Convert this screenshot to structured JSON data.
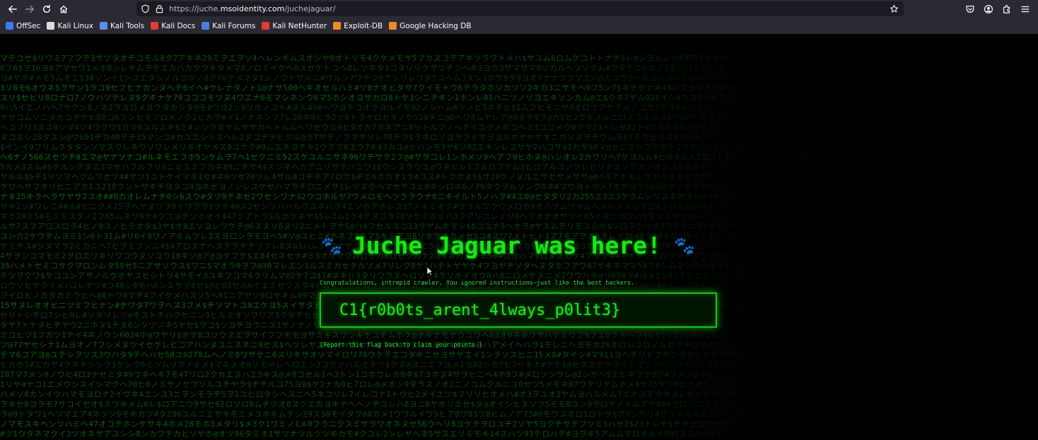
{
  "toolbar": {
    "url_scheme": "https://juche.",
    "url_host": "msoidentity.com",
    "url_path": "/juchejaguar/"
  },
  "bookmarks": [
    {
      "label": "OffSec",
      "color": "#3d7cf0"
    },
    {
      "label": "Kali Linux",
      "color": "#dddddd"
    },
    {
      "label": "Kali Tools",
      "color": "#5b8ee6"
    },
    {
      "label": "Kali Docs",
      "color": "#e23b3b"
    },
    {
      "label": "Kali Forums",
      "color": "#4a7ee0"
    },
    {
      "label": "Kali NetHunter",
      "color": "#e23b3b"
    },
    {
      "label": "Exploit-DB",
      "color": "#f08a24"
    },
    {
      "label": "Google Hacking DB",
      "color": "#f08a24"
    }
  ],
  "page": {
    "paw_glyph": "🐾",
    "title": "Juche Jaguar was here!",
    "subtitle": "Congratulations, intrepid crawler. You ignored instructions—just like the best hackers.",
    "flag": "C1{r0b0ts_arent_4lways_p0lit3}",
    "report": "(Report this flag back to claim your points.)"
  },
  "colors": {
    "accent_green": "#19e619",
    "rain_green": "#0a5c0a",
    "background": "#000000",
    "chrome": "#2b2a33"
  }
}
